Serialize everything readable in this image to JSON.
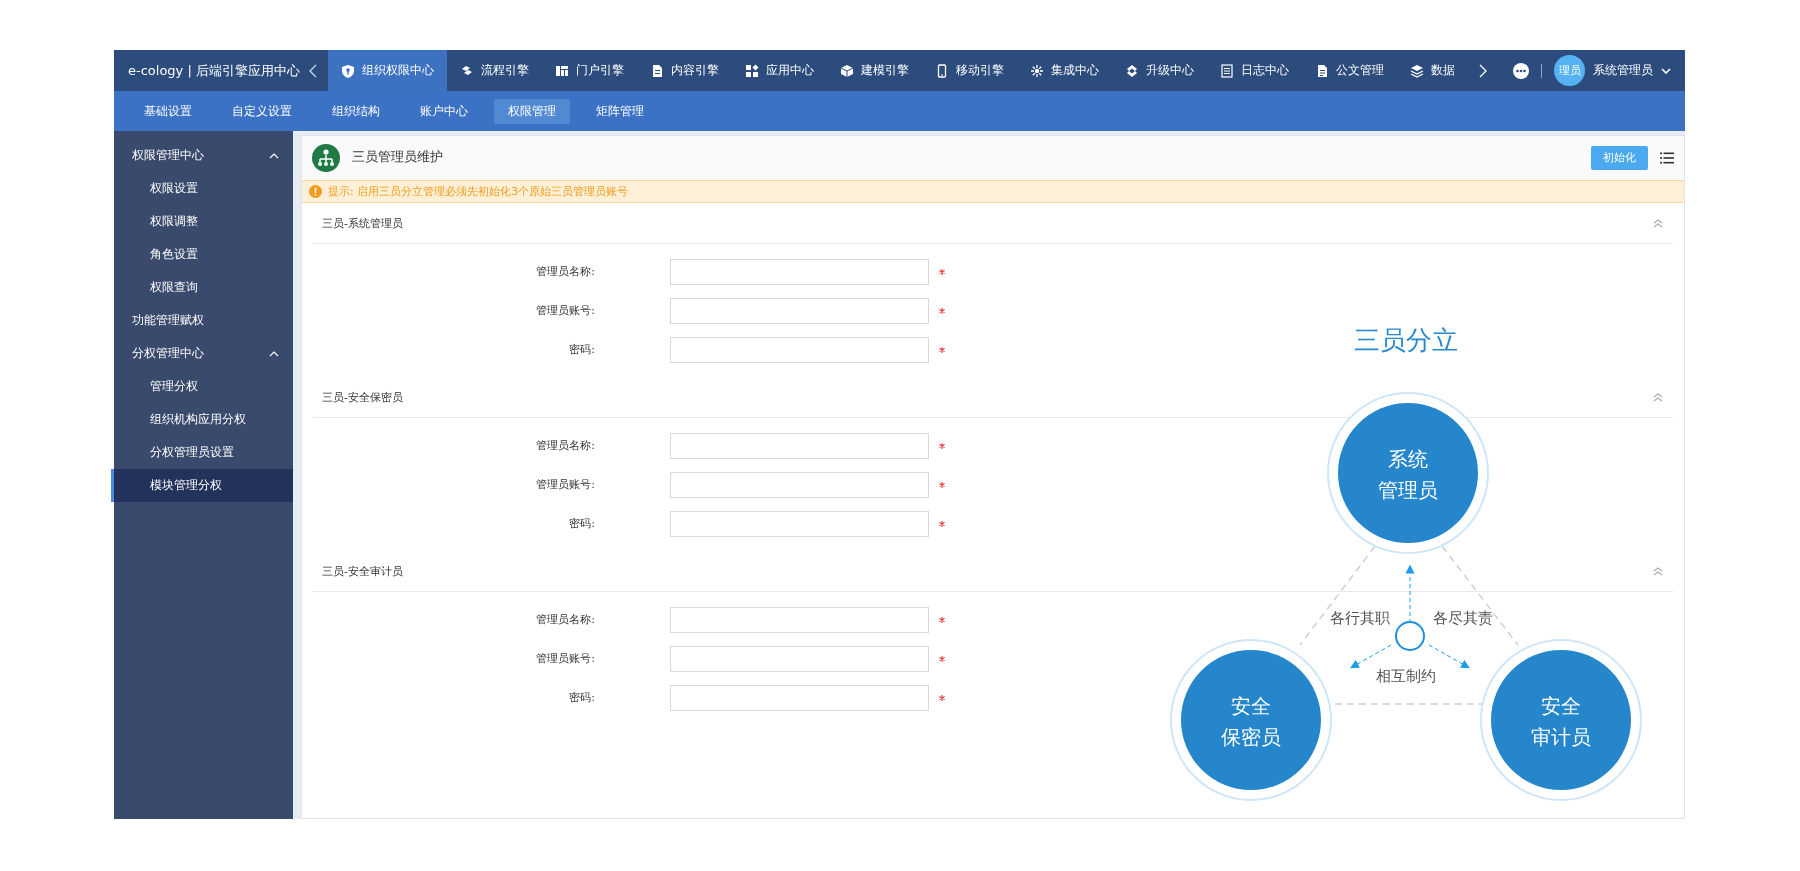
{
  "brand": "e-cology | 后端引擎应用中心",
  "top_nav": [
    {
      "label": "组织权限中心",
      "selected": true
    },
    {
      "label": "流程引擎",
      "selected": false
    },
    {
      "label": "门户引擎",
      "selected": false
    },
    {
      "label": "内容引擎",
      "selected": false
    },
    {
      "label": "应用中心",
      "selected": false
    },
    {
      "label": "建模引擎",
      "selected": false
    },
    {
      "label": "移动引擎",
      "selected": false
    },
    {
      "label": "集成中心",
      "selected": false
    },
    {
      "label": "升级中心",
      "selected": false
    },
    {
      "label": "日志中心",
      "selected": false
    },
    {
      "label": "公文管理",
      "selected": false
    },
    {
      "label": "数据",
      "selected": false
    }
  ],
  "user": {
    "avatar_text": "理员",
    "name": "系统管理员"
  },
  "sub_nav": [
    {
      "label": "基础设置",
      "selected": false
    },
    {
      "label": "自定义设置",
      "selected": false
    },
    {
      "label": "组织结构",
      "selected": false
    },
    {
      "label": "账户中心",
      "selected": false
    },
    {
      "label": "权限管理",
      "selected": true
    },
    {
      "label": "矩阵管理",
      "selected": false
    }
  ],
  "sidebar": [
    {
      "label": "权限管理中心",
      "expanded": true,
      "selected": false,
      "children": [
        {
          "label": "权限设置",
          "selected": false
        },
        {
          "label": "权限调整",
          "selected": false
        },
        {
          "label": "角色设置",
          "selected": false
        },
        {
          "label": "权限查询",
          "selected": false
        }
      ]
    },
    {
      "label": "功能管理赋权",
      "selected": false
    },
    {
      "label": "分权管理中心",
      "expanded": true,
      "selected": false,
      "children": [
        {
          "label": "管理分权",
          "selected": false
        },
        {
          "label": "组织机构应用分权",
          "selected": false
        },
        {
          "label": "分权管理员设置",
          "selected": false
        },
        {
          "label": "模块管理分权",
          "selected": true
        }
      ]
    }
  ],
  "panel": {
    "title": "三员管理员维护",
    "init_button": "初始化",
    "notice": "提示: 启用三员分立管理必须先初始化3个原始三员管理员账号",
    "sections": [
      {
        "title": "三员-系统管理员",
        "expanded": true,
        "fields": [
          {
            "label": "管理员名称:",
            "required": true
          },
          {
            "label": "管理员账号:",
            "required": true
          },
          {
            "label": "密码:",
            "required": true
          }
        ]
      },
      {
        "title": "三员-安全保密员",
        "expanded": true,
        "fields": [
          {
            "label": "管理员名称:",
            "required": true
          },
          {
            "label": "管理员账号:",
            "required": true
          },
          {
            "label": "密码:",
            "required": true
          }
        ]
      },
      {
        "title": "三员-安全审计员",
        "expanded": true,
        "fields": [
          {
            "label": "管理员名称:",
            "required": true
          },
          {
            "label": "管理员账号:",
            "required": true
          },
          {
            "label": "密码:",
            "required": true
          }
        ]
      }
    ]
  },
  "diagram": {
    "title": "三员分立",
    "roles": [
      {
        "lines": [
          "系统",
          "管理员"
        ]
      },
      {
        "lines": [
          "安全",
          "保密员"
        ]
      },
      {
        "lines": [
          "安全",
          "审计员"
        ]
      }
    ],
    "relations": [
      "各行其职",
      "各尽其责"
    ],
    "center_label": "相互制约"
  }
}
